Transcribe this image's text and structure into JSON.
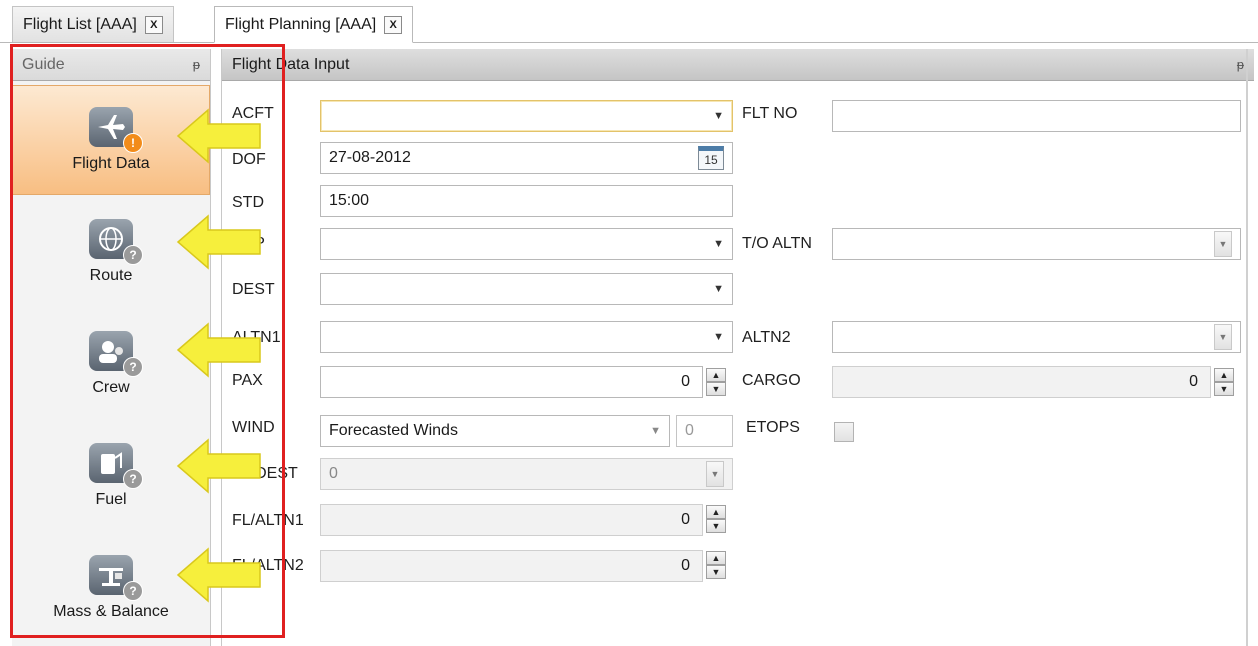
{
  "tabs": [
    {
      "label": "Flight List [AAA]",
      "close": "X"
    },
    {
      "label": "Flight Planning [AAA]",
      "close": "X"
    }
  ],
  "guide": {
    "title": "Guide",
    "pin": "ᵽ",
    "items": [
      {
        "label": "Flight Data",
        "icon": "airplane-icon",
        "badge": "!"
      },
      {
        "label": "Route",
        "icon": "globe-icon",
        "badge": "?"
      },
      {
        "label": "Crew",
        "icon": "crew-icon",
        "badge": "?"
      },
      {
        "label": "Fuel",
        "icon": "fuel-icon",
        "badge": "?"
      },
      {
        "label": "Mass & Balance",
        "icon": "scale-icon",
        "badge": "?"
      }
    ]
  },
  "flight_data_input": {
    "title": "Flight Data Input",
    "pin": "ᵽ",
    "labels": {
      "acft": "ACFT",
      "dof": "DOF",
      "std": "STD",
      "dep": "DEP",
      "dest": "DEST",
      "altn1": "ALTN1",
      "pax": "PAX",
      "wind": "WIND",
      "fl_dest": "FL/DEST",
      "fl_altn1": "FL/ALTN1",
      "fl_altn2": "FL/ALTN2",
      "flt_no": "FLT NO",
      "to_altn": "T/O ALTN",
      "altn2": "ALTN2",
      "cargo": "CARGO",
      "etops": "ETOPS"
    },
    "values": {
      "acft": "",
      "dof": "27-08-2012",
      "calendar_day": "15",
      "std": "15:00",
      "dep": "",
      "dest": "",
      "altn1": "",
      "pax": "0",
      "wind": "Forecasted Winds",
      "wind_extra": "0",
      "fl_dest": "0",
      "fl_altn1": "0",
      "fl_altn2": "0",
      "flt_no": "",
      "to_altn": "",
      "altn2": "",
      "cargo": "0",
      "etops_checked": false
    }
  },
  "colors": {
    "highlight": "#e02020",
    "arrow": "#f6ef3c",
    "selected_item": "#f8be82"
  }
}
